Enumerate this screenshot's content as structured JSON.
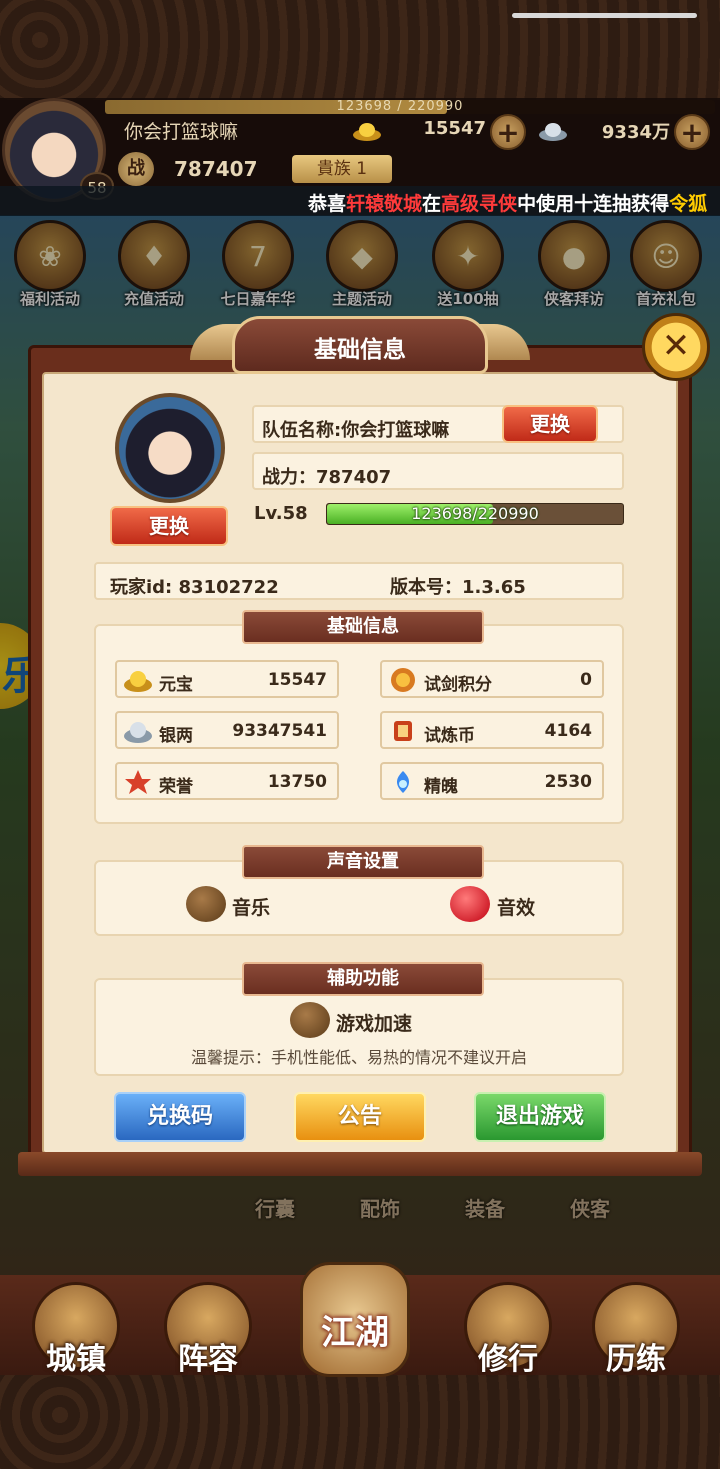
{
  "top_bar": {
    "exp_text": "123698 / 220990",
    "exp_fraction": 0.56,
    "level_badge": "58",
    "player_name": "你会打篮球嘛",
    "gold": "15547",
    "silver": "9334万",
    "power_icon": "战",
    "power": "787407",
    "noble": "貴族 1"
  },
  "ticker": {
    "prefix": "恭喜",
    "player": "轩辕敬城",
    "mid1": "在",
    "event": "高级寻侠",
    "mid2": "中使用十连抽获得",
    "reward": "令狐"
  },
  "activities": [
    {
      "label": "福利活动",
      "icon": "gift-icon"
    },
    {
      "label": "充值活动",
      "icon": "card-icon"
    },
    {
      "label": "七日嘉年华",
      "icon": "slot-icon"
    },
    {
      "label": "主题活动",
      "icon": "ingot-icon"
    },
    {
      "label": "送100抽",
      "icon": "scroll-icon"
    },
    {
      "label": "侠客拜访",
      "icon": "bag-icon"
    },
    {
      "label": "首充礼包",
      "icon": "hero-icon"
    }
  ],
  "scene_labels": [
    "行囊",
    "配饰",
    "装备",
    "侠客"
  ],
  "nav": {
    "town": "城镇",
    "lineup": "阵容",
    "jianghu": "江湖",
    "practice": "修行",
    "trial": "历练"
  },
  "modal": {
    "title": "基础信息",
    "close_icon": "close-icon",
    "team_name": "队伍名称:你会打篮球嘛",
    "rename_button": "更换",
    "avatar_button": "更换",
    "power_field": "战力：787407",
    "level": "Lv.58",
    "level_bar_text": "123698/220990",
    "level_fraction": 0.56,
    "player_id": "玩家id: 83102722",
    "version": "版本号：1.3.65",
    "basic_section": "基础信息",
    "resources": [
      {
        "label": "元宝",
        "value": "15547",
        "icon": "gold-ingot-icon"
      },
      {
        "label": "试剑积分",
        "value": "0",
        "icon": "sword-points-icon"
      },
      {
        "label": "银两",
        "value": "93347541",
        "icon": "silver-ingot-icon"
      },
      {
        "label": "试炼币",
        "value": "4164",
        "icon": "trial-coin-icon"
      },
      {
        "label": "荣誉",
        "value": "13750",
        "icon": "honor-icon"
      },
      {
        "label": "精魄",
        "value": "2530",
        "icon": "spirit-icon"
      }
    ],
    "sound_section": "声音设置",
    "music_label": "音乐",
    "sfx_label": "音效",
    "assist_section": "辅助功能",
    "speedup_label": "游戏加速",
    "tip": "温馨提示：手机性能低、易热的情况不建议开启",
    "redeem_button": "兑换码",
    "notice_button": "公告",
    "exit_button": "退出游戏"
  },
  "colors": {
    "modal_bg": "#f4e6cc",
    "frame": "#6a2e1c",
    "accent_red": "#c02a18",
    "blue_button": "#4a8ad8",
    "yellow_button": "#f8b830",
    "green_button": "#4ab84a"
  }
}
